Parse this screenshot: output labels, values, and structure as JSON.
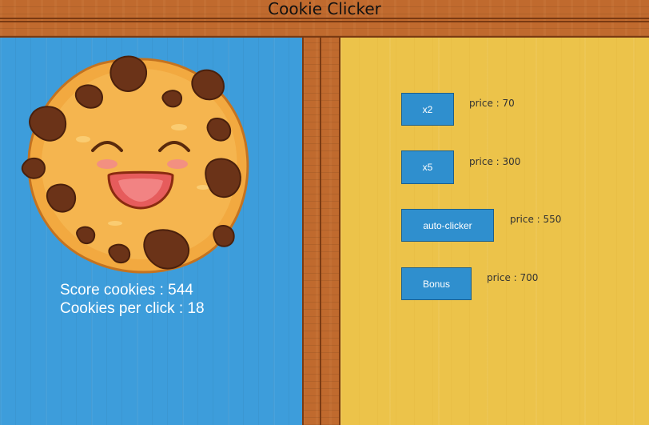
{
  "app": {
    "title": "Cookie Clicker"
  },
  "stats": {
    "score_text": "Score cookies : 544",
    "per_click_text": "Cookies per click : 18"
  },
  "shop": {
    "items": [
      {
        "label": "x2",
        "price_text": "price : 70"
      },
      {
        "label": "x5",
        "price_text": "price : 300"
      },
      {
        "label": "auto-clicker",
        "price_text": "price : 550"
      },
      {
        "label": "Bonus",
        "price_text": "price : 700"
      }
    ]
  },
  "colors": {
    "left_panel": "#3d9ddb",
    "right_panel": "#ecc34a",
    "wood": "#c06a2e",
    "button": "#2f8fce"
  }
}
